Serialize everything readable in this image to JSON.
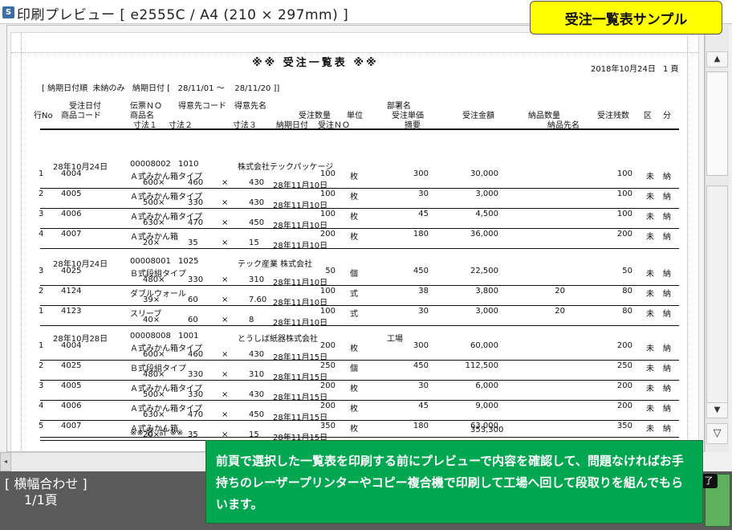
{
  "window": {
    "title": "印刷プレビュー [ e2555C / A4 (210 × 297mm) ]"
  },
  "callout": "受注一覧表サンプル",
  "report": {
    "title": "※※ 受注一覧表 ※※",
    "date": "2018年10月24日",
    "page": "1 頁",
    "filter": "[ 納期日付順  未納のみ   納期日付 [   28/11/01 ～    28/11/20 ]]",
    "hdr1": {
      "c1": "受注日付",
      "c2": "伝票ＮＯ",
      "c3": "得意先コード",
      "c4": "得意先名",
      "c5": "部署名"
    },
    "hdr2": {
      "c1": "行No",
      "c2": "商品コード",
      "c3": "商品名",
      "c4": "受注数量",
      "c5": "単位",
      "c6": "受注単価",
      "c7": "受注金額",
      "c8": "納品数量",
      "c9": "受注残数",
      "c10": "区",
      "c11": "分"
    },
    "hdr3": {
      "c1": "寸法１",
      "c2": "寸法２",
      "c3": "寸法３",
      "c4": "納期日付",
      "c5": "受注ＮＯ",
      "c6": "摘要",
      "c7": "納品先名"
    },
    "groups": [
      {
        "date": "28年10月24日",
        "slip": "00008002",
        "cust_code": "1010",
        "cust_name": "株式会社テックパッケージ",
        "dept": "",
        "lines": [
          {
            "no": "1",
            "code": "4004",
            "name": "Ａ式みかん箱タイプ",
            "d1": "600×",
            "d2": "460",
            "x": "×",
            "d3": "430",
            "due": "28年11月10日",
            "qty": "100",
            "unit": "枚",
            "price": "300",
            "amount": "30,000",
            "dqty": "",
            "rem": "100",
            "k": "未",
            "b": "納"
          },
          {
            "no": "2",
            "code": "4005",
            "name": "Ａ式みかん箱タイプ",
            "d1": "500×",
            "d2": "330",
            "x": "×",
            "d3": "430",
            "due": "28年11月10日",
            "qty": "100",
            "unit": "枚",
            "price": "30",
            "amount": "3,000",
            "dqty": "",
            "rem": "100",
            "k": "未",
            "b": "納"
          },
          {
            "no": "3",
            "code": "4006",
            "name": "Ａ式みかん箱タイプ",
            "d1": "630×",
            "d2": "470",
            "x": "×",
            "d3": "450",
            "due": "28年11月10日",
            "qty": "100",
            "unit": "枚",
            "price": "45",
            "amount": "4,500",
            "dqty": "",
            "rem": "100",
            "k": "未",
            "b": "納"
          },
          {
            "no": "4",
            "code": "4007",
            "name": "Ａ式みかん箱",
            "d1": "20×",
            "d2": "35",
            "x": "×",
            "d3": "15",
            "due": "28年11月10日",
            "qty": "200",
            "unit": "枚",
            "price": "180",
            "amount": "36,000",
            "dqty": "",
            "rem": "200",
            "k": "未",
            "b": "納"
          }
        ]
      },
      {
        "date": "28年10月24日",
        "slip": "00008001",
        "cust_code": "1025",
        "cust_name": "テック産業 株式会社",
        "dept": "",
        "lines": [
          {
            "no": "3",
            "code": "4025",
            "name": "Ｂ式段組タイプ",
            "d1": "480×",
            "d2": "330",
            "x": "×",
            "d3": "310",
            "due": "28年11月10日",
            "qty": "50",
            "unit": "個",
            "price": "450",
            "amount": "22,500",
            "dqty": "",
            "rem": "50",
            "k": "未",
            "b": "納"
          },
          {
            "no": "2",
            "code": "4124",
            "name": "ダブルウォール",
            "d1": "39×",
            "d2": "60",
            "x": "×",
            "d3": "7.60",
            "due": "28年11月10日",
            "qty": "100",
            "unit": "式",
            "price": "38",
            "amount": "3,800",
            "dqty": "20",
            "rem": "80",
            "k": "未",
            "b": "納"
          },
          {
            "no": "1",
            "code": "4123",
            "name": "スリーブ",
            "d1": "40×",
            "d2": "60",
            "x": "×",
            "d3": "8",
            "due": "28年11月10日",
            "qty": "100",
            "unit": "式",
            "price": "30",
            "amount": "3,000",
            "dqty": "20",
            "rem": "80",
            "k": "未",
            "b": "納"
          }
        ]
      },
      {
        "date": "28年10月28日",
        "slip": "00008008",
        "cust_code": "1001",
        "cust_name": "とうしば紙器株式会社",
        "dept": "工場",
        "lines": [
          {
            "no": "1",
            "code": "4004",
            "name": "Ａ式みかん箱タイプ",
            "d1": "600×",
            "d2": "460",
            "x": "×",
            "d3": "430",
            "due": "28年11月15日",
            "qty": "200",
            "unit": "枚",
            "price": "300",
            "amount": "60,000",
            "dqty": "",
            "rem": "200",
            "k": "未",
            "b": "納"
          },
          {
            "no": "2",
            "code": "4025",
            "name": "Ｂ式段組タイプ",
            "d1": "480×",
            "d2": "330",
            "x": "×",
            "d3": "310",
            "due": "28年11月15日",
            "qty": "250",
            "unit": "個",
            "price": "450",
            "amount": "112,500",
            "dqty": "",
            "rem": "250",
            "k": "未",
            "b": "納"
          },
          {
            "no": "3",
            "code": "4005",
            "name": "Ａ式みかん箱タイプ",
            "d1": "500×",
            "d2": "330",
            "x": "×",
            "d3": "430",
            "due": "28年11月15日",
            "qty": "200",
            "unit": "枚",
            "price": "30",
            "amount": "6,000",
            "dqty": "",
            "rem": "200",
            "k": "未",
            "b": "納"
          },
          {
            "no": "4",
            "code": "4006",
            "name": "Ａ式みかん箱タイプ",
            "d1": "630×",
            "d2": "470",
            "x": "×",
            "d3": "450",
            "due": "28年11月15日",
            "qty": "200",
            "unit": "枚",
            "price": "45",
            "amount": "9,000",
            "dqty": "",
            "rem": "200",
            "k": "未",
            "b": "納"
          },
          {
            "no": "5",
            "code": "4007",
            "name": "Ａ式みかん箱",
            "d1": "20×",
            "d2": "35",
            "x": "×",
            "d3": "15",
            "due": "28年11月15日",
            "qty": "350",
            "unit": "枚",
            "price": "180",
            "amount": "63,000",
            "dqty": "",
            "rem": "350",
            "k": "未",
            "b": "納"
          }
        ]
      }
    ],
    "total_label": "※※ 合  計 ※※",
    "total_amount": "353,300"
  },
  "status": {
    "fit": "[ 横幅合わせ ]",
    "pages": "1/1頁",
    "right_label": "了"
  },
  "note": "前頁で選択した一覧表を印刷する前にプレビューで内容を確認して、問題なければお手持ちのレーザープリンターやコピー複合機で印刷して工場へ回して段取りを組んでもらいます。",
  "scroll": {
    "up": "▲",
    "down": "▼",
    "down2": "▽"
  },
  "icons": {
    "app": "app-icon",
    "scroll_up": "scroll-up-icon",
    "scroll_down": "scroll-down-icon"
  }
}
